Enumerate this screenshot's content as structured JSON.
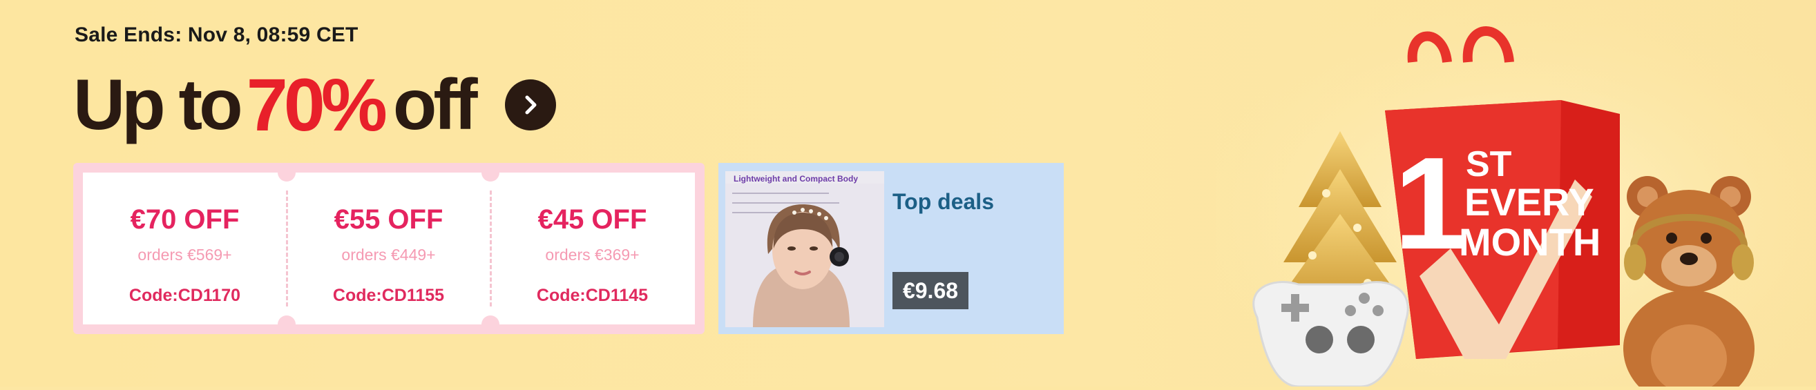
{
  "promo": {
    "sale_ends": "Sale Ends: Nov 8, 08:59 CET",
    "headline_prefix": "Up to",
    "headline_percent": "70%",
    "headline_suffix": "off"
  },
  "coupons": [
    {
      "amount": "€70 OFF",
      "condition": "orders €569+",
      "code": "Code:CD1170"
    },
    {
      "amount": "€55 OFF",
      "condition": "orders €449+",
      "code": "Code:CD1155"
    },
    {
      "amount": "€45 OFF",
      "condition": "orders €369+",
      "code": "Code:CD1145"
    }
  ],
  "deal": {
    "label": "Top deals",
    "price": "€9.68",
    "image_title": "Lightweight and Compact Body"
  },
  "hero": {
    "bag_text_line1": "1",
    "bag_text_line2": "ST",
    "bag_text_line3": "EVERY",
    "bag_text_line4": "MONTH"
  },
  "icons": {
    "arrow": "chevron-right-icon",
    "tree": "christmas-tree-icon",
    "controller": "gamepad-icon",
    "bear": "teddy-bear-icon"
  },
  "colors": {
    "background": "#fde7a3",
    "headline_dark": "#2a1a12",
    "headline_accent": "#e8202a",
    "coupon_text": "#e5235f",
    "coupon_border": "#fcd3dd",
    "deal_bg": "#c9def6",
    "deal_label": "#1c5f86",
    "price_bg": "#4d555d",
    "bag_red": "#e8332b"
  }
}
